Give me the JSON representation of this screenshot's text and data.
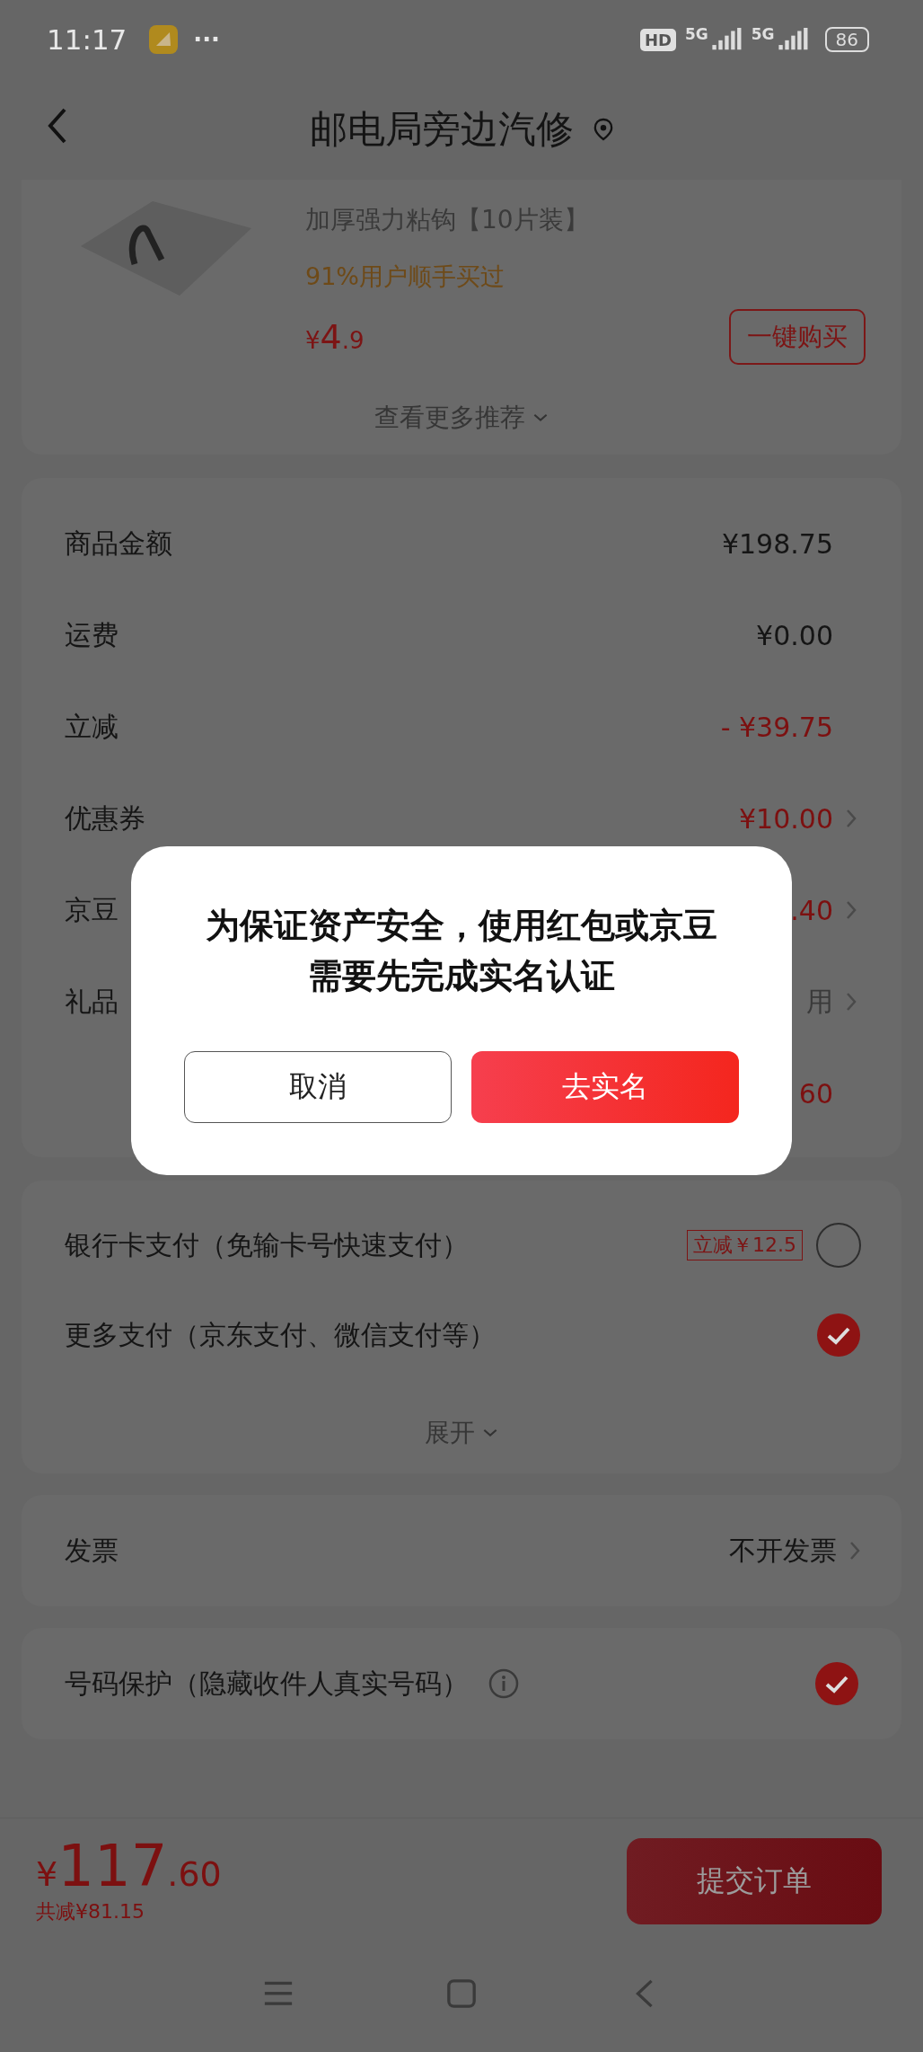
{
  "status_bar": {
    "time": "11:17",
    "more": "···",
    "hd_badge": "HD",
    "networks": [
      "5G",
      "5G"
    ],
    "battery": "86"
  },
  "header": {
    "title": "邮电局旁边汽修"
  },
  "product": {
    "name": "加厚强力粘钩【10片装】",
    "social_proof": "91%用户顺手买过",
    "currency": "¥",
    "price_int": "4",
    "price_dec": ".9",
    "buy_button": "一键购买",
    "more": "查看更多推荐"
  },
  "summary": {
    "rows": [
      {
        "label": "商品金额",
        "value": "¥198.75",
        "kind": "plain",
        "chevron": false
      },
      {
        "label": "运费",
        "value": "¥0.00",
        "kind": "plain",
        "chevron": false
      },
      {
        "label": "立减",
        "value": "- ¥39.75",
        "kind": "discount",
        "chevron": false
      },
      {
        "label": "优惠券",
        "value": "¥10.00",
        "kind": "discount",
        "chevron": true
      },
      {
        "label": "京豆",
        "value": ".40",
        "kind": "discount",
        "chevron": true
      },
      {
        "label": "礼品",
        "value": "用",
        "kind": "muted",
        "chevron": true
      },
      {
        "label": "",
        "value": "60",
        "kind": "discount",
        "chevron": false
      }
    ]
  },
  "payment": {
    "options": [
      {
        "label": "银行卡支付（免输卡号快速支付）",
        "badge": "立减￥12.5",
        "selected": false
      },
      {
        "label": "更多支付（京东支付、微信支付等）",
        "selected": true
      }
    ],
    "expand": "展开"
  },
  "invoice": {
    "label": "发票",
    "value": "不开发票"
  },
  "privacy": {
    "label": "号码保护（隐藏收件人真实号码）",
    "checked": true
  },
  "footer": {
    "currency": "¥",
    "amount_int": "117",
    "amount_dec": ".60",
    "saved": "共减¥81.15",
    "submit": "提交订单"
  },
  "dialog": {
    "message": [
      "为保证资产安全，使用红包或京豆",
      "需要先完成实名认证"
    ],
    "cancel": "取消",
    "confirm": "去实名"
  }
}
